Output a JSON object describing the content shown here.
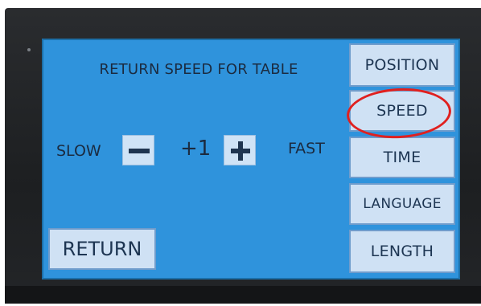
{
  "screen": {
    "title": "RETURN SPEED FOR TABLE",
    "speed_control": {
      "slow_label": "SLOW",
      "fast_label": "FAST",
      "value": "+1",
      "decrease_icon": "minus-icon",
      "increase_icon": "plus-icon"
    },
    "menu": {
      "items": [
        {
          "label": "POSITION"
        },
        {
          "label": "SPEED"
        },
        {
          "label": "TIME"
        },
        {
          "label": "LANGUAGE"
        },
        {
          "label": "LENGTH"
        }
      ]
    },
    "return_label": "RETURN"
  },
  "colors": {
    "screen_background": "#2f93dc",
    "button_fill": "#cfe1f4",
    "annotation_circle": "#e0201f"
  }
}
